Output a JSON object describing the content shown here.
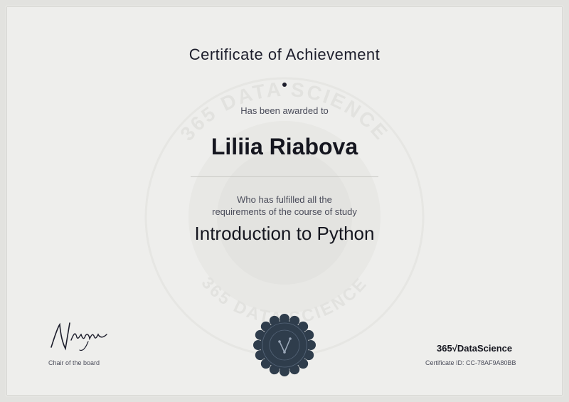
{
  "certificate": {
    "title": "Certificate of Achievement",
    "awarded_text": "Has been awarded to",
    "recipient_name": "Liliia Riabova",
    "fulfilled_line1": "Who has fulfilled all the",
    "fulfilled_line2": "requirements of the course of study",
    "course_name": "Introduction to Python",
    "chair_title": "Chair of the board",
    "brand_logo": "365√DataScience",
    "certificate_id_label": "Certificate ID:",
    "certificate_id_value": "CC-78AF9A80BB",
    "watermark_text": "365 DATA SCIENCE",
    "signature_text": "N.Krastev"
  },
  "colors": {
    "background": "#eeeeec",
    "text": "#1d1e2c",
    "seal": "#2f3d4c"
  },
  "icons": [
    "signature-icon",
    "seal-icon",
    "watermark-icon"
  ]
}
